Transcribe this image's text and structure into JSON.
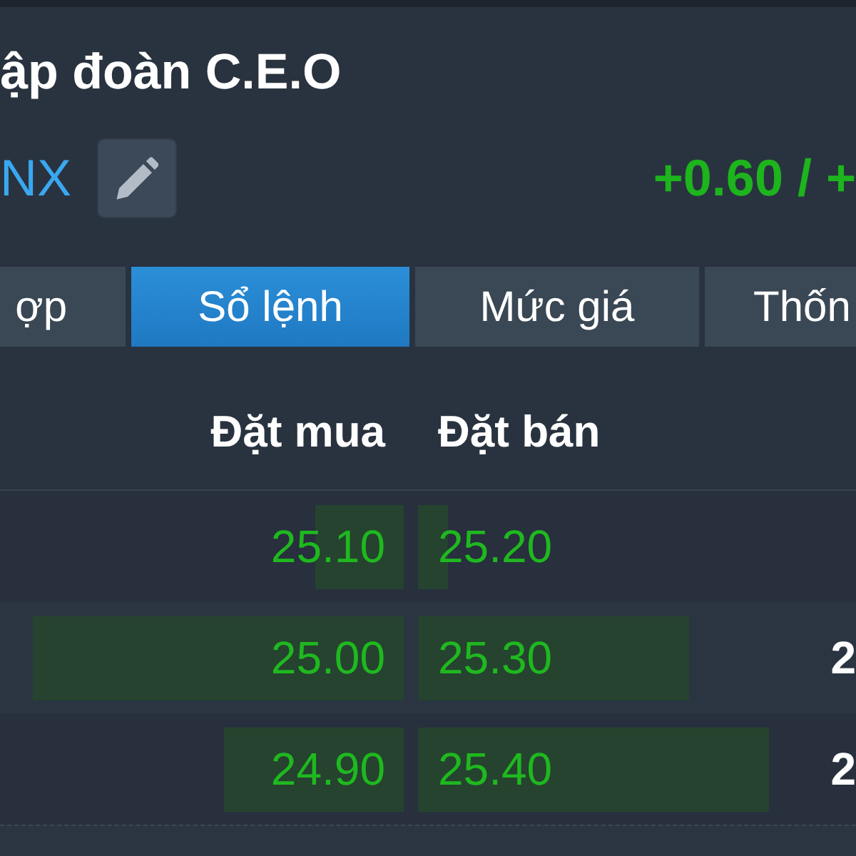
{
  "header": {
    "title": "ập đoàn C.E.O",
    "symbol": "NX",
    "change": "+0.60 / +"
  },
  "tabs": [
    {
      "label": "ợp",
      "selected": false
    },
    {
      "label": "Sổ lệnh",
      "selected": true
    },
    {
      "label": "Mức giá",
      "selected": false
    },
    {
      "label": "Thốn",
      "selected": false
    }
  ],
  "order_book": {
    "columns": [
      "Đặt mua",
      "Đặt bán"
    ],
    "rows": [
      {
        "bid": {
          "price": "25.10",
          "level": 0.22
        },
        "ask": {
          "price": "25.20",
          "level": 0.075
        }
      },
      {
        "bid": {
          "price": "25.00",
          "level": 0.92
        },
        "ask": {
          "price": "25.30",
          "level": 0.68
        },
        "column_4": "2"
      },
      {
        "bid": {
          "price": "24.90",
          "level": 0.445
        },
        "ask": {
          "price": "25.40",
          "level": 0.88
        },
        "column_4": "2"
      }
    ]
  }
}
